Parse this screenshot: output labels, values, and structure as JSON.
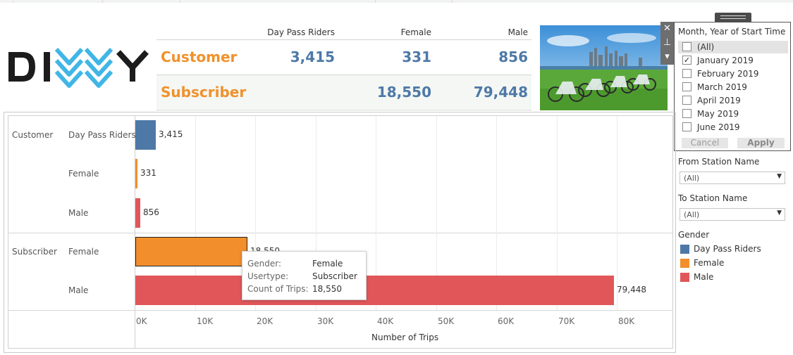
{
  "logo": {
    "text": "DIVVY"
  },
  "summary": {
    "headers": [
      "Day Pass Riders",
      "Female",
      "Male"
    ],
    "rows": [
      {
        "label": "Customer",
        "values": [
          "3,415",
          "331",
          "856"
        ]
      },
      {
        "label": "Subscriber",
        "values": [
          "",
          "18,550",
          "79,448"
        ]
      }
    ]
  },
  "filter_popup": {
    "title": "Month, Year of Start Time",
    "items": [
      {
        "label": "(All)",
        "checked": false
      },
      {
        "label": "January 2019",
        "checked": true
      },
      {
        "label": "February 2019",
        "checked": false
      },
      {
        "label": "March 2019",
        "checked": false
      },
      {
        "label": "April 2019",
        "checked": false
      },
      {
        "label": "May 2019",
        "checked": false
      },
      {
        "label": "June 2019",
        "checked": false
      }
    ],
    "cancel_label": "Cancel",
    "apply_label": "Apply",
    "close_glyph": "✕",
    "pin_glyph": "⊥",
    "menu_glyph": "▾"
  },
  "filters": {
    "from_station": {
      "label": "From Station Name",
      "value": "(All)"
    },
    "to_station": {
      "label": "To Station Name",
      "value": "(All)"
    }
  },
  "legend": {
    "title": "Gender",
    "items": [
      {
        "label": "Day Pass Riders",
        "color": "#4e79a7"
      },
      {
        "label": "Female",
        "color": "#f28e2b"
      },
      {
        "label": "Male",
        "color": "#e15759"
      }
    ]
  },
  "chart_data": {
    "type": "bar",
    "orientation": "horizontal",
    "groups": [
      {
        "usertype": "Customer",
        "bars": [
          {
            "category": "Day Pass Riders",
            "value": 3415,
            "label": "3,415",
            "color": "#4e79a7"
          },
          {
            "category": "Female",
            "value": 331,
            "label": "331",
            "color": "#f28e2b"
          },
          {
            "category": "Male",
            "value": 856,
            "label": "856",
            "color": "#e15759"
          }
        ]
      },
      {
        "usertype": "Subscriber",
        "bars": [
          {
            "category": "Female",
            "value": 18550,
            "label": "18,550",
            "color": "#f28e2b"
          },
          {
            "category": "Male",
            "value": 79448,
            "label": "79,448",
            "color": "#e15759"
          }
        ]
      }
    ],
    "xlabel": "Number of Trips",
    "xlim": [
      0,
      90000
    ],
    "ticks": [
      {
        "value": 0,
        "label": "0K"
      },
      {
        "value": 10000,
        "label": "10K"
      },
      {
        "value": 20000,
        "label": "20K"
      },
      {
        "value": 30000,
        "label": "30K"
      },
      {
        "value": 40000,
        "label": "40K"
      },
      {
        "value": 50000,
        "label": "50K"
      },
      {
        "value": 60000,
        "label": "60K"
      },
      {
        "value": 70000,
        "label": "70K"
      },
      {
        "value": 80000,
        "label": "80K"
      }
    ],
    "grid": true
  },
  "tooltip": {
    "rows": [
      {
        "key": "Gender:",
        "value": "Female"
      },
      {
        "key": "Usertype:",
        "value": "Subscriber"
      },
      {
        "key": "Count of Trips:",
        "value": "18,550"
      }
    ]
  }
}
